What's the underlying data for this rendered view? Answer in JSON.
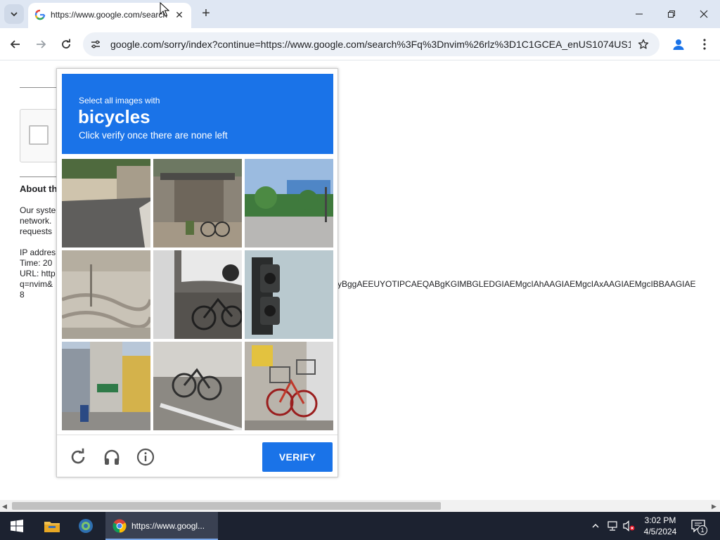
{
  "browser": {
    "tab_title": "https://www.google.com/search",
    "url": "google.com/sorry/index?continue=https://www.google.com/search%3Fq%3Dnvim%26rlz%3D1C1GCEA_enUS1074US1..."
  },
  "page": {
    "about_heading": "About th",
    "about_lines": [
      "Our syste",
      "network.",
      "requests"
    ],
    "ip_lines": [
      "IP addres",
      "Time: 20",
      "URL: http",
      "q=nvim&",
      "8"
    ],
    "long_url_fragment": "yBggAEEUYOTIPCAEQABgKGIMBGLEDGIAEMgcIAhAAGIAEMgcIAxAAGIAEMgcIBBAAGIAE"
  },
  "captcha": {
    "instruction_line1": "Select all images with",
    "target": "bicycles",
    "instruction_line3": "Click verify once there are none left",
    "verify_label": "VERIFY",
    "accent_color": "#1a73e8",
    "tiles": [
      {
        "name": "tile-1",
        "scene": "street corner with wall"
      },
      {
        "name": "tile-2",
        "scene": "bicycles under awning"
      },
      {
        "name": "tile-3",
        "scene": "intersection with buildings"
      },
      {
        "name": "tile-4",
        "scene": "paved plaza"
      },
      {
        "name": "tile-5",
        "scene": "bicycle beside car"
      },
      {
        "name": "tile-6",
        "scene": "traffic light"
      },
      {
        "name": "tile-7",
        "scene": "shopping street"
      },
      {
        "name": "tile-8",
        "scene": "parked bicycles"
      },
      {
        "name": "tile-9",
        "scene": "red bicycle with basket"
      }
    ]
  },
  "taskbar": {
    "chrome_label": "https://www.googl...",
    "time": "3:02 PM",
    "date": "4/5/2024",
    "notification_count": "1"
  }
}
